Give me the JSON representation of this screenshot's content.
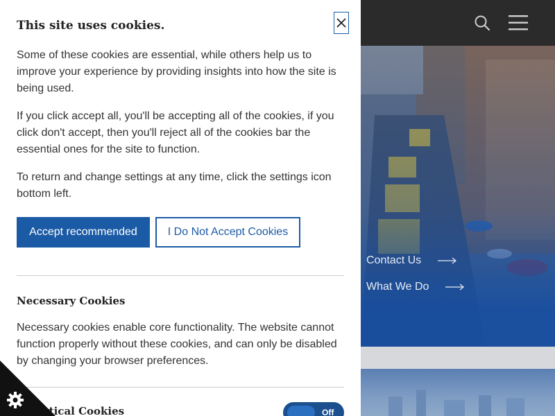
{
  "header": {
    "search_icon": "search-icon",
    "menu_icon": "hamburger-menu-icon"
  },
  "hero": {
    "links": [
      {
        "label": "Contact Us"
      },
      {
        "label": "What We Do"
      }
    ]
  },
  "cookie_panel": {
    "title": "This site uses cookies.",
    "close_icon": "close-icon",
    "paragraphs": [
      "Some of these cookies are essential, while others help us to improve your experience by providing insights into how the site is being used.",
      "If you click accept all, you'll be accepting all of the cookies, if you click don't accept, then you'll reject all of the cookies bar the essential ones for the site to function.",
      "To return and change settings at any time, click the settings icon bottom left."
    ],
    "accept_label": "Accept recommended",
    "decline_label": "I Do Not Accept Cookies",
    "sections": [
      {
        "title": "Necessary Cookies",
        "description": "Necessary cookies enable core functionality. The website cannot function properly without these cookies, and can only be disabled by changing your browser preferences."
      },
      {
        "title": "Analytical Cookies",
        "toggle_label": "Off"
      }
    ]
  },
  "settings": {
    "icon": "gear-icon"
  },
  "colors": {
    "accent": "#1b5aa5",
    "header_bg": "#2b2b2b"
  }
}
